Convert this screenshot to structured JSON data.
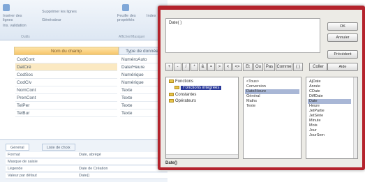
{
  "ribbon": {
    "row1": "Insérer des lignes",
    "row1b": "Supprimer les lignes",
    "row2": "Ins. validation",
    "row2b": "Générateur",
    "row3": "Feuille des propriétés",
    "row3b": "Index",
    "group1": "Outils",
    "group2": "Afficher/Masquer"
  },
  "grid": {
    "col_name": "Nom du champ",
    "col_type": "Type de données",
    "rows": [
      {
        "name": "CodCont",
        "type": "NuméroAuto"
      },
      {
        "name": "DatCré",
        "type": "Date/Heure"
      },
      {
        "name": "CodSoc",
        "type": "Numérique"
      },
      {
        "name": "CodCiv",
        "type": "Numérique"
      },
      {
        "name": "NomCont",
        "type": "Texte"
      },
      {
        "name": "PrenCont",
        "type": "Texte"
      },
      {
        "name": "TelPer",
        "type": "Texte"
      },
      {
        "name": "TelBur",
        "type": "Texte"
      }
    ]
  },
  "lower": {
    "tab_general": "Général",
    "tab_lookup": "Liste de choix",
    "props": [
      {
        "label": "Format",
        "value": "Date, abrégé"
      },
      {
        "label": "Masque de saisie",
        "value": ""
      },
      {
        "label": "Légende",
        "value": "Date de Création"
      },
      {
        "label": "Valeur par défaut",
        "value": "Date()"
      }
    ]
  },
  "dialog": {
    "expression": "Date( )",
    "buttons": {
      "ok": "OK",
      "cancel": "Annuler",
      "undo": "Précédent",
      "help": "Aide"
    },
    "operators": [
      "+",
      "-",
      "/",
      "*",
      "&",
      "=",
      ">",
      "<",
      "<>",
      "Et",
      "Ou",
      "Pas",
      "Comme",
      "( )",
      "Coller"
    ],
    "tree": [
      {
        "label": "Fonctions",
        "selected": false
      },
      {
        "label": "Fonctions intégrées",
        "selected": true
      },
      {
        "label": "Constantes",
        "selected": false
      },
      {
        "label": "Opérateurs",
        "selected": false
      }
    ],
    "categories": [
      {
        "label": "<Tous>",
        "selected": false
      },
      {
        "label": "Conversion",
        "selected": false
      },
      {
        "label": "Date/Heure",
        "selected": true
      },
      {
        "label": "Général",
        "selected": false
      },
      {
        "label": "Maths",
        "selected": false
      },
      {
        "label": "Texte",
        "selected": false
      }
    ],
    "functions": [
      {
        "label": "AjDate",
        "selected": false
      },
      {
        "label": "Année",
        "selected": false
      },
      {
        "label": "CDate",
        "selected": false
      },
      {
        "label": "DiffDate",
        "selected": false
      },
      {
        "label": "Date",
        "selected": true
      },
      {
        "label": "Heure",
        "selected": false
      },
      {
        "label": "JetPartie",
        "selected": false
      },
      {
        "label": "JetSérie",
        "selected": false
      },
      {
        "label": "Minute",
        "selected": false
      },
      {
        "label": "Mois",
        "selected": false
      },
      {
        "label": "Jour",
        "selected": false
      },
      {
        "label": "JourSem",
        "selected": false
      }
    ],
    "status": "Date()"
  },
  "colors": {
    "dialog_frame": "#b4232c",
    "selection": "#2b3a9a",
    "header_gold": "#f7c56b"
  }
}
